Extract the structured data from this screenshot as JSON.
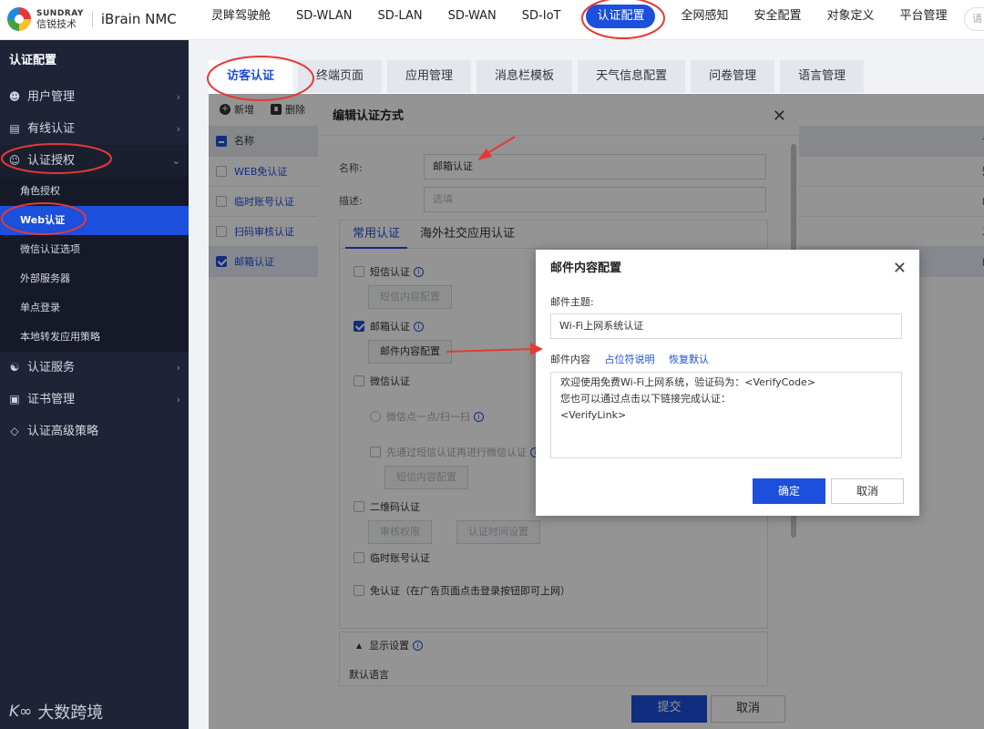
{
  "brand": {
    "logo_en": "SUNDRAY",
    "logo_cn": "信锐技术",
    "app_name": "iBrain NMC"
  },
  "topnav": {
    "items": [
      "灵眸驾驶舱",
      "SD-WLAN",
      "SD-LAN",
      "SD-WAN",
      "SD-IoT",
      "认证配置",
      "全网感知",
      "安全配置",
      "对象定义",
      "平台管理"
    ],
    "active_index": 5,
    "search_placeholder": "请"
  },
  "sidebar": {
    "title": "认证配置",
    "items": [
      {
        "label": "用户管理",
        "icon": "user-icon"
      },
      {
        "label": "有线认证",
        "icon": "id-card-icon"
      },
      {
        "label": "认证授权",
        "icon": "user-key-icon",
        "open": true
      },
      {
        "label": "认证服务",
        "icon": "user-gear-icon"
      },
      {
        "label": "证书管理",
        "icon": "certificate-icon"
      },
      {
        "label": "认证高级策略",
        "icon": "diamond-icon"
      }
    ],
    "subitems": [
      "角色授权",
      "Web认证",
      "微信认证选项",
      "外部服务器",
      "单点登录",
      "本地转发应用策略"
    ],
    "active_sub": 1
  },
  "tabs": {
    "items": [
      "访客认证",
      "终端页面",
      "应用管理",
      "消息栏模板",
      "天气信息配置",
      "问卷管理",
      "语言管理"
    ],
    "active_index": 0
  },
  "toolbar": {
    "add": "新增",
    "delete": "删除"
  },
  "table": {
    "header": "名称",
    "header_right": "认",
    "rows": [
      {
        "name": "WEB免认证",
        "right": "短",
        "checked": false
      },
      {
        "name": "临时账号认证",
        "right": "临",
        "checked": false
      },
      {
        "name": "扫码审核认证",
        "right": "二",
        "checked": false
      },
      {
        "name": "邮箱认证",
        "right": "邮",
        "checked": true
      }
    ]
  },
  "edit_dialog": {
    "title": "编辑认证方式",
    "name_label": "名称:",
    "name_value": "邮箱认证",
    "desc_label": "描述:",
    "desc_placeholder": "选填",
    "subtabs": [
      "常用认证",
      "海外社交应用认证"
    ],
    "sms": {
      "label": "短信认证",
      "button": "短信内容配置"
    },
    "email": {
      "label": "邮箱认证",
      "button": "邮件内容配置"
    },
    "wechat": {
      "label": "微信认证",
      "radio": "微信点一点/扫一扫",
      "pre_sms": "先通过短信认证再进行微信认证",
      "button": "短信内容配置"
    },
    "qr": {
      "label": "二维码认证",
      "button1": "审核权限",
      "button2": "认证时间设置"
    },
    "temp_account": "临时账号认证",
    "no_auth": "免认证（在广告页面点击登录按钮即可上网）",
    "display_settings": "显示设置",
    "default_language": "默认语言",
    "submit": "提交",
    "cancel": "取消"
  },
  "email_dialog": {
    "title": "邮件内容配置",
    "subject_label": "邮件主题:",
    "subject_value": "Wi-Fi上网系统认证",
    "content_label": "邮件内容",
    "placeholder_link": "占位符说明",
    "reset_link": "恢复默认",
    "content": "欢迎使用免费Wi-Fi上网系统，验证码为：<VerifyCode>\n您也可以通过点击以下链接完成认证：\n<VerifyLink>",
    "ok": "确定",
    "cancel": "取消"
  },
  "watermark": {
    "text": "大数跨境"
  },
  "colors": {
    "accent": "#1c4fdb",
    "sidebar_bg": "#1e2337",
    "annotation": "#e53935"
  }
}
